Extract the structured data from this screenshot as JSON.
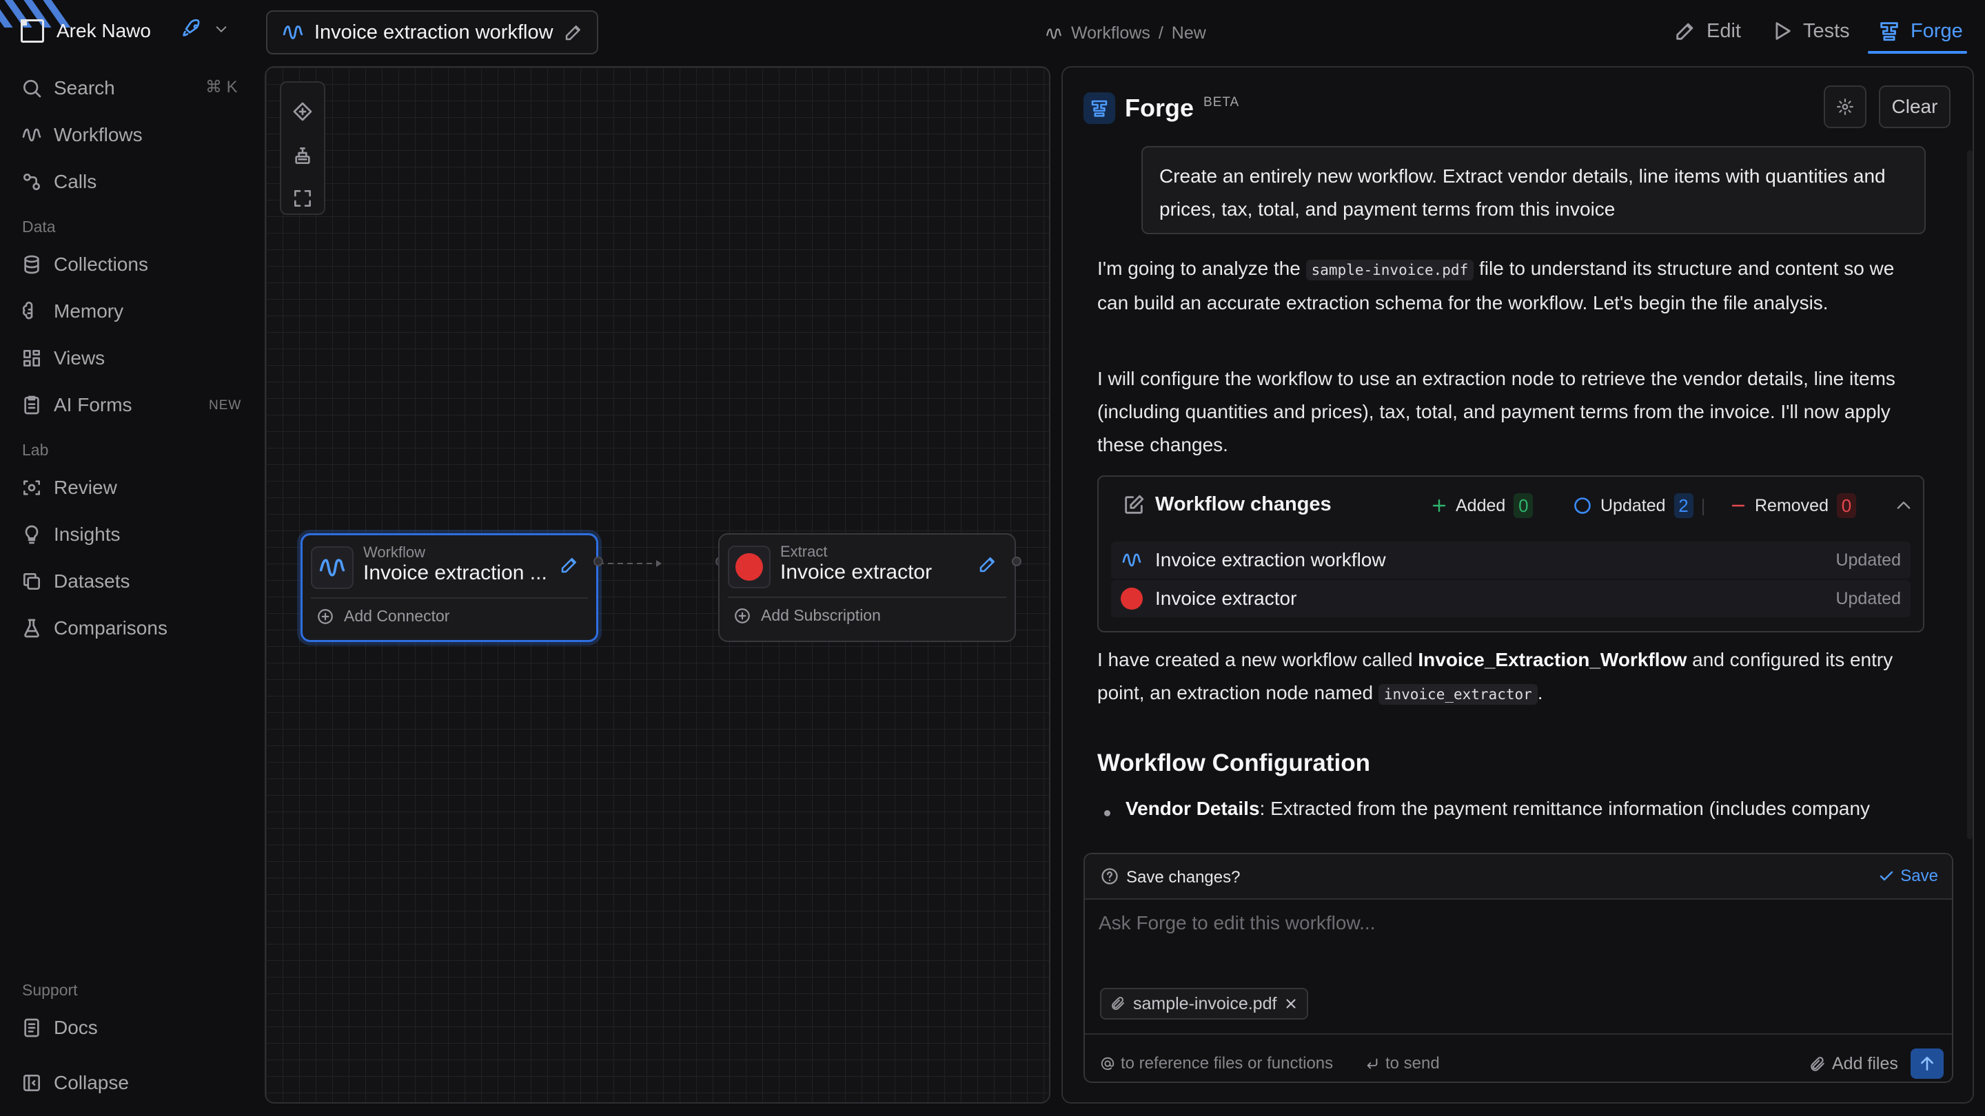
{
  "sidebar": {
    "user_name": "Arek Nawo",
    "search_label": "Search",
    "search_shortcut": "⌘ K",
    "items_top": [
      {
        "label": "Workflows",
        "icon": "workflow-icon"
      },
      {
        "label": "Calls",
        "icon": "calls-icon"
      }
    ],
    "section_data": "Data",
    "items_data": [
      {
        "label": "Collections",
        "icon": "database-icon"
      },
      {
        "label": "Memory",
        "icon": "brain-icon"
      },
      {
        "label": "Views",
        "icon": "grid-icon"
      },
      {
        "label": "AI Forms",
        "icon": "clipboard-icon",
        "badge": "NEW"
      }
    ],
    "section_lab": "Lab",
    "items_lab": [
      {
        "label": "Review",
        "icon": "eye-scan-icon"
      },
      {
        "label": "Insights",
        "icon": "lightbulb-icon"
      },
      {
        "label": "Datasets",
        "icon": "copy-icon"
      },
      {
        "label": "Comparisons",
        "icon": "flask-icon"
      }
    ],
    "section_support": "Support",
    "docs_label": "Docs",
    "collapse_label": "Collapse"
  },
  "topbar": {
    "workflow_title": "Invoice extraction workflow",
    "breadcrumb_root": "Workflows",
    "breadcrumb_sep": "/",
    "breadcrumb_current": "New",
    "tabs": [
      {
        "label": "Edit",
        "icon": "pencil-icon"
      },
      {
        "label": "Tests",
        "icon": "play-icon"
      },
      {
        "label": "Forge",
        "icon": "forge-icon",
        "active": true
      }
    ]
  },
  "canvas": {
    "nodes": [
      {
        "type": "Workflow",
        "name": "Invoice extraction ...",
        "footer": "Add Connector",
        "selected": true
      },
      {
        "type": "Extract",
        "name": "Invoice extractor",
        "footer": "Add Subscription",
        "selected": false
      }
    ]
  },
  "forge": {
    "title": "Forge",
    "beta": "BETA",
    "clear_label": "Clear",
    "user_prompt": "Create an entirely new workflow. Extract vendor details, line items with quantities and prices, tax, total, and payment terms from this invoice",
    "msg1_a": "I'm going to analyze the ",
    "msg1_code": "sample-invoice.pdf",
    "msg1_b": " file to understand its structure and content so we can build an accurate extraction schema for the workflow. Let's begin the file analysis.",
    "msg2": "I will configure the workflow to use an extraction node to retrieve the vendor details, line items (including quantities and prices), tax, total, and payment terms from the invoice. I'll now apply these changes.",
    "changes": {
      "title": "Workflow changes",
      "added_label": "Added",
      "added_count": "0",
      "updated_label": "Updated",
      "updated_count": "2",
      "removed_label": "Removed",
      "removed_count": "0",
      "rows": [
        {
          "name": "Invoice extraction workflow",
          "status": "Updated"
        },
        {
          "name": "Invoice extractor",
          "status": "Updated"
        }
      ]
    },
    "msg3_a": "I have created a new workflow called ",
    "msg3_bold": "Invoice_Extraction_Workflow",
    "msg3_b": " and configured its entry point, an extraction node named ",
    "msg3_code": "invoice_extractor",
    "msg3_c": ".",
    "heading": "Workflow Configuration",
    "bullet_bold": "Vendor Details",
    "bullet_text": ": Extracted from the payment remittance information (includes company",
    "save_prompt": "Save changes?",
    "save_label": "Save",
    "input_placeholder": "Ask Forge to edit this workflow...",
    "attachment": "sample-invoice.pdf",
    "hint_reference": "to reference files or functions",
    "hint_send": "to send",
    "add_files": "Add files"
  },
  "colors": {
    "accent": "#3b8cff",
    "extract_red": "#e03131",
    "added_green": "#2fb36b",
    "removed_red": "#e5484d"
  }
}
